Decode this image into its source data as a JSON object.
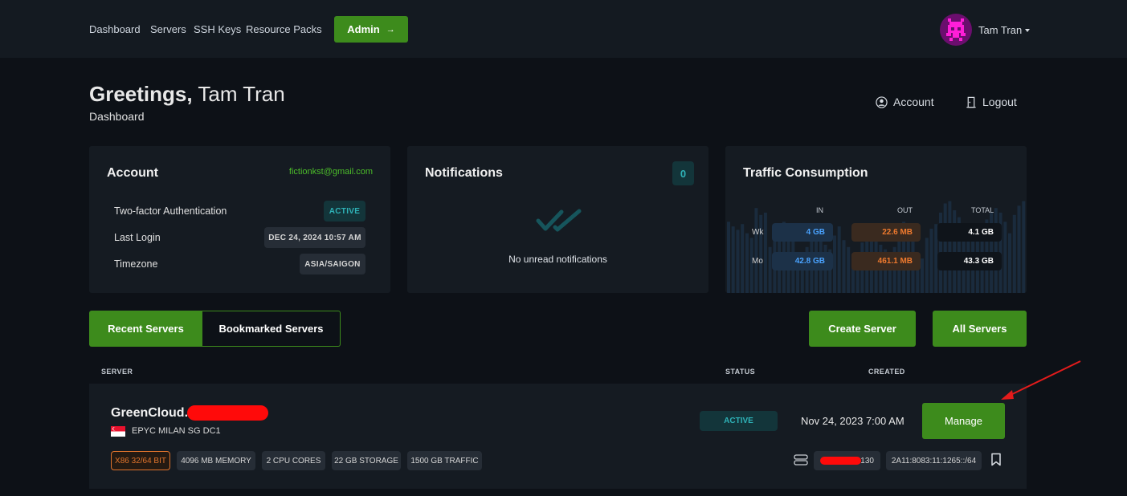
{
  "nav": {
    "links": [
      "Dashboard",
      "Servers",
      "SSH Keys",
      "Resource Packs"
    ],
    "admin_label": "Admin",
    "user_name": "Tam Tran"
  },
  "header": {
    "greeting_bold": "Greetings,",
    "greeting_name": "Tam Tran",
    "subtitle": "Dashboard",
    "account_label": "Account",
    "logout_label": "Logout"
  },
  "account_card": {
    "title": "Account",
    "email": "fictionkst@gmail.com",
    "rows": [
      {
        "label": "Two-factor Authentication",
        "value": "ACTIVE"
      },
      {
        "label": "Last Login",
        "value": "DEC 24, 2024 10:57 AM"
      },
      {
        "label": "Timezone",
        "value": "ASIA/SAIGON"
      }
    ]
  },
  "notifications_card": {
    "title": "Notifications",
    "count": "0",
    "empty_text": "No unread notifications"
  },
  "traffic_card": {
    "title": "Traffic Consumption",
    "columns": [
      "IN",
      "OUT",
      "TOTAL"
    ],
    "rows": [
      {
        "label": "Wk",
        "in": "4 GB",
        "out": "22.6 MB",
        "total": "4.1 GB"
      },
      {
        "label": "Mo",
        "in": "42.8 GB",
        "out": "461.1 MB",
        "total": "43.3 GB"
      }
    ],
    "bars": [
      0.62,
      0.58,
      0.55,
      0.6,
      0.52,
      0.48,
      0.74,
      0.68,
      0.7,
      0.4,
      0.5,
      0.56,
      0.62,
      0.5,
      0.45,
      0.35,
      0.3,
      0.4,
      0.55,
      0.6,
      0.48,
      0.42,
      0.38,
      0.5,
      0.58,
      0.46,
      0.4,
      0.34,
      0.3,
      0.44,
      0.52,
      0.6,
      0.5,
      0.42,
      0.38,
      0.3,
      0.4,
      0.5,
      0.62,
      0.55,
      0.45,
      0.35,
      0.3,
      0.48,
      0.56,
      0.6,
      0.7,
      0.78,
      0.8,
      0.72,
      0.66,
      0.6,
      0.54,
      0.5,
      0.48,
      0.56,
      0.64,
      0.7,
      0.74,
      0.7,
      0.62,
      0.52,
      0.68,
      0.76,
      0.8
    ]
  },
  "tabs": {
    "recent": "Recent Servers",
    "bookmarked": "Bookmarked Servers"
  },
  "actions": {
    "create": "Create Server",
    "all": "All Servers"
  },
  "table": {
    "headers": {
      "server": "SERVER",
      "status": "STATUS",
      "created": "CREATED"
    }
  },
  "server": {
    "name": "GreenCloud.",
    "location": "EPYC MILAN SG DC1",
    "status": "ACTIVE",
    "created": "Nov 24, 2023 7:00 AM",
    "manage_label": "Manage",
    "specs": [
      "X86 32/64 BIT",
      "4096 MB MEMORY",
      "2 CPU CORES",
      "22 GB STORAGE",
      "1500 GB TRAFFIC"
    ],
    "ipv4_suffix": ".130",
    "ipv6": "2A11:8083:11:1265::/64"
  },
  "colors": {
    "accent_green": "#3d8b1c",
    "teal_badge": "#1f9aa0",
    "in_blue": "#4aa3ff",
    "out_orange": "#f07a2e",
    "redaction": "#ff0a0a"
  }
}
